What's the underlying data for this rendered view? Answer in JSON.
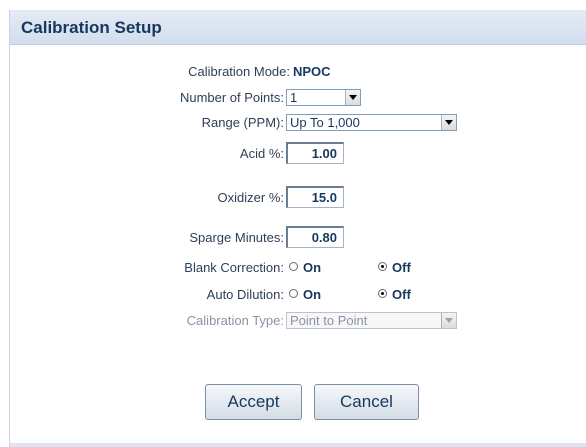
{
  "panel": {
    "title": "Calibration Setup"
  },
  "form": {
    "calibration_mode": {
      "label": "Calibration Mode:",
      "value": "NPOC"
    },
    "number_of_points": {
      "label": "Number of Points:",
      "value": "1"
    },
    "range": {
      "label": "Range (PPM):",
      "value": "Up To 1,000"
    },
    "acid": {
      "label": "Acid %:",
      "value": "1.00"
    },
    "oxidizer": {
      "label": "Oxidizer %:",
      "value": "15.0"
    },
    "sparge": {
      "label": "Sparge Minutes:",
      "value": "0.80"
    },
    "blank_correction": {
      "label": "Blank Correction:",
      "options": [
        {
          "label": "On",
          "checked": false
        },
        {
          "label": "Off",
          "checked": true
        }
      ]
    },
    "auto_dilution": {
      "label": "Auto Dilution:",
      "options": [
        {
          "label": "On",
          "checked": false
        },
        {
          "label": "Off",
          "checked": true
        }
      ]
    },
    "calibration_type": {
      "label": "Calibration Type:",
      "value": "Point to Point",
      "disabled": true
    }
  },
  "buttons": {
    "accept": "Accept",
    "cancel": "Cancel"
  },
  "colors": {
    "header_bg": "#d9e3f0",
    "title": "#17375e",
    "text": "#2f3f55"
  }
}
